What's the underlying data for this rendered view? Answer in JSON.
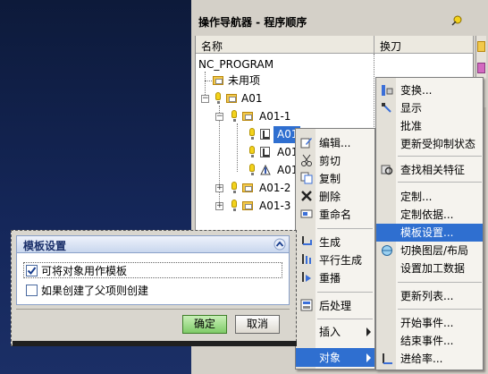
{
  "navigator": {
    "title": "操作导航器 - 程序顺序",
    "columns": [
      "名称",
      "换刀"
    ],
    "rows": [
      {
        "label": "NC_PROGRAM"
      },
      {
        "label": "未用项"
      },
      {
        "label": "A01"
      },
      {
        "label": "A01-1"
      },
      {
        "label": "A01"
      },
      {
        "label": "A01"
      },
      {
        "label": "A01"
      },
      {
        "label": "A01-2"
      },
      {
        "label": "A01-3"
      }
    ]
  },
  "context_menu": {
    "items": [
      "编辑...",
      "剪切",
      "复制",
      "删除",
      "重命名",
      "生成",
      "平行生成",
      "重播",
      "后处理",
      "插入",
      "对象"
    ],
    "icons": [
      "edit-icon",
      "cut-icon",
      "copy-icon",
      "delete-icon",
      "rename-icon",
      "generate-icon",
      "parallel-generate-icon",
      "replay-icon",
      "postprocess-icon"
    ]
  },
  "sub_menu": {
    "items": [
      "变换...",
      "显示",
      "批准",
      "更新受抑制状态",
      "查找相关特征",
      "定制...",
      "定制依据...",
      "模板设置...",
      "切换图层/布局",
      "设置加工数据",
      "更新列表...",
      "开始事件...",
      "结束事件...",
      "进给率..."
    ],
    "highlighted": "模板设置..."
  },
  "dialog": {
    "title": "模板设置",
    "checkboxes": [
      {
        "label": "可将对象用作模板",
        "checked": true
      },
      {
        "label": "如果创建了父项则创建",
        "checked": false
      }
    ],
    "ok_label": "确定",
    "cancel_label": "取消"
  },
  "colors": {
    "highlight": "#2f6fd0",
    "ok_button": "#8fd17a",
    "bulb": "#f3d21c"
  }
}
